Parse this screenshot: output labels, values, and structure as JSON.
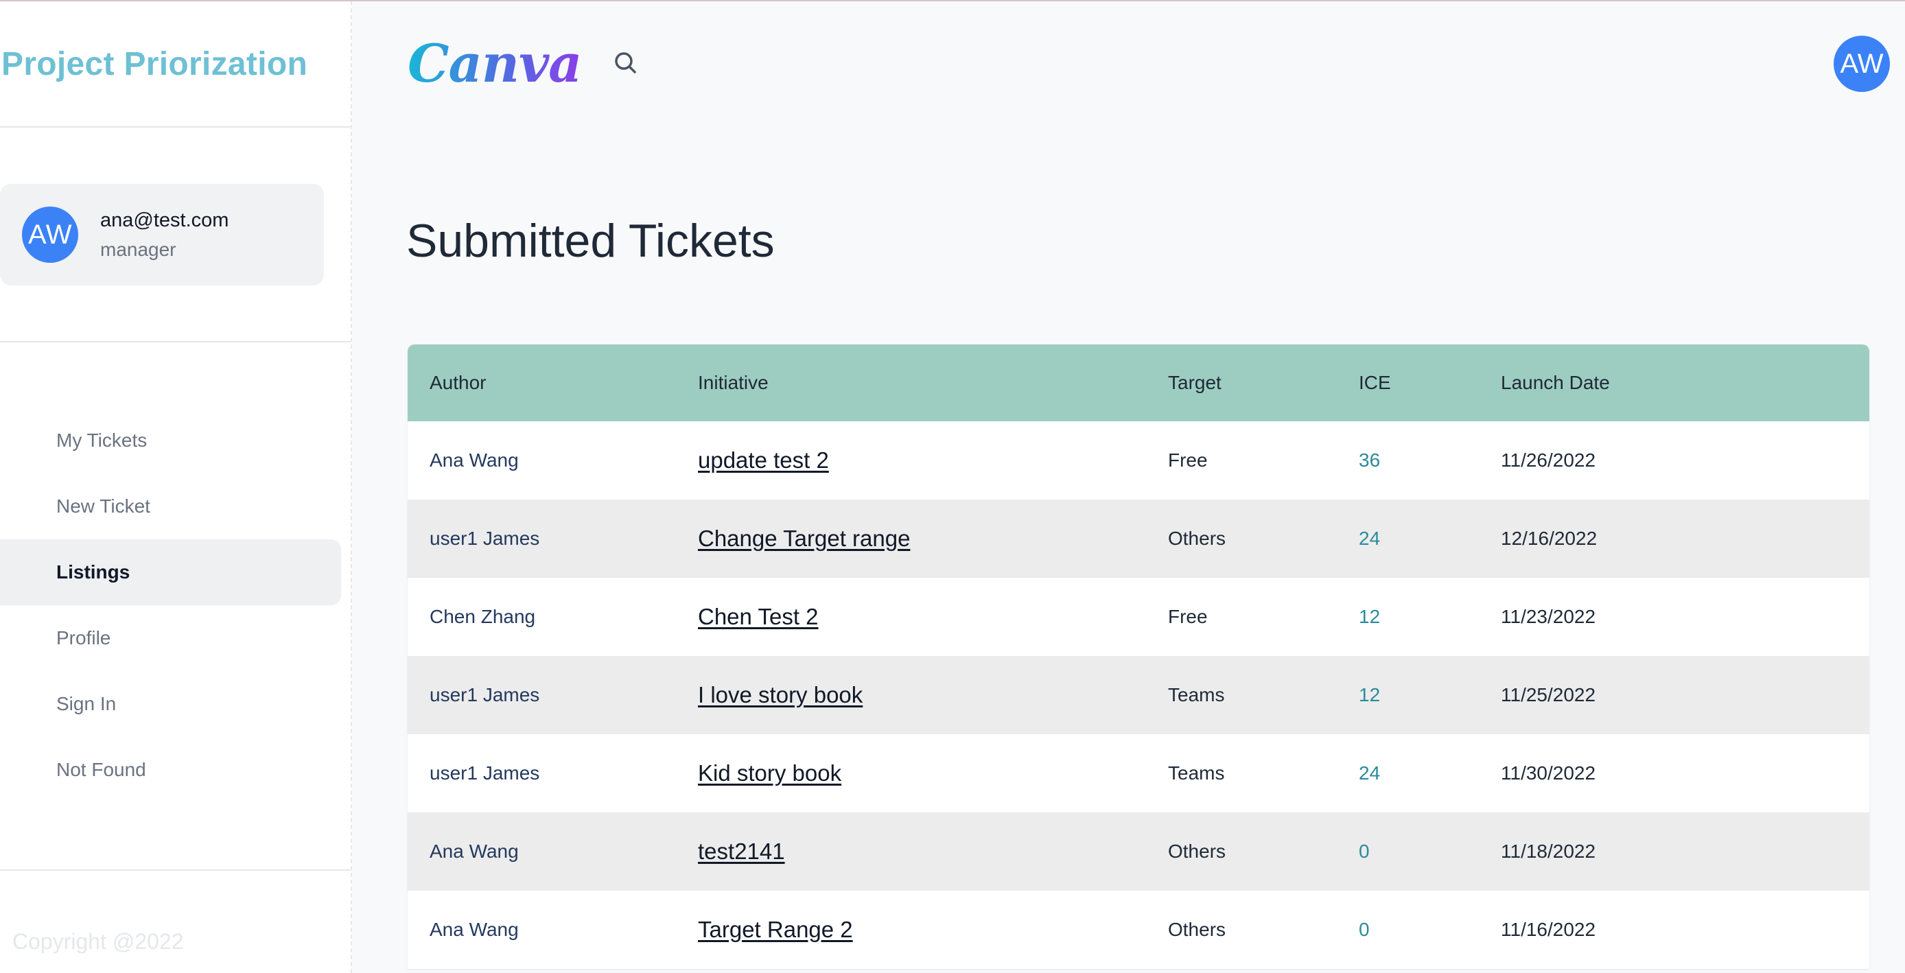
{
  "sidebar": {
    "brand": "Project Priorization",
    "user": {
      "avatar_initials": "AW",
      "email": "ana@test.com",
      "role": "manager"
    },
    "nav": [
      {
        "label": "My Tickets",
        "active": false
      },
      {
        "label": "New Ticket",
        "active": false
      },
      {
        "label": "Listings",
        "active": true
      },
      {
        "label": "Profile",
        "active": false
      },
      {
        "label": "Sign In",
        "active": false
      },
      {
        "label": "Not Found",
        "active": false
      }
    ],
    "copyright": "Copyright @2022"
  },
  "header": {
    "logo": "Canva",
    "search_icon": "search-icon",
    "avatar_initials": "AW"
  },
  "main": {
    "title": "Submitted Tickets",
    "table": {
      "columns": [
        "Author",
        "Initiative",
        "Target",
        "ICE",
        "Launch Date"
      ],
      "rows": [
        {
          "author": "Ana Wang",
          "initiative": "update test 2",
          "target": "Free",
          "ice": "36",
          "date": "11/26/2022"
        },
        {
          "author": "user1 James",
          "initiative": "Change Target range",
          "target": "Others",
          "ice": "24",
          "date": "12/16/2022"
        },
        {
          "author": "Chen Zhang",
          "initiative": "Chen Test 2",
          "target": "Free",
          "ice": "12",
          "date": "11/23/2022"
        },
        {
          "author": "user1 James",
          "initiative": "I love story book",
          "target": "Teams",
          "ice": "12",
          "date": "11/25/2022"
        },
        {
          "author": "user1 James",
          "initiative": "Kid story book",
          "target": "Teams",
          "ice": "24",
          "date": "11/30/2022"
        },
        {
          "author": "Ana Wang",
          "initiative": "test2141",
          "target": "Others",
          "ice": "0",
          "date": "11/18/2022"
        },
        {
          "author": "Ana Wang",
          "initiative": "Target Range 2",
          "target": "Others",
          "ice": "0",
          "date": "11/16/2022"
        }
      ]
    }
  },
  "colors": {
    "brand": "#6ec0d4",
    "avatar": "#3b82f6",
    "table_header": "#9dcdc1",
    "ice_value": "#2b8a9a",
    "row_alt": "#ececec"
  }
}
